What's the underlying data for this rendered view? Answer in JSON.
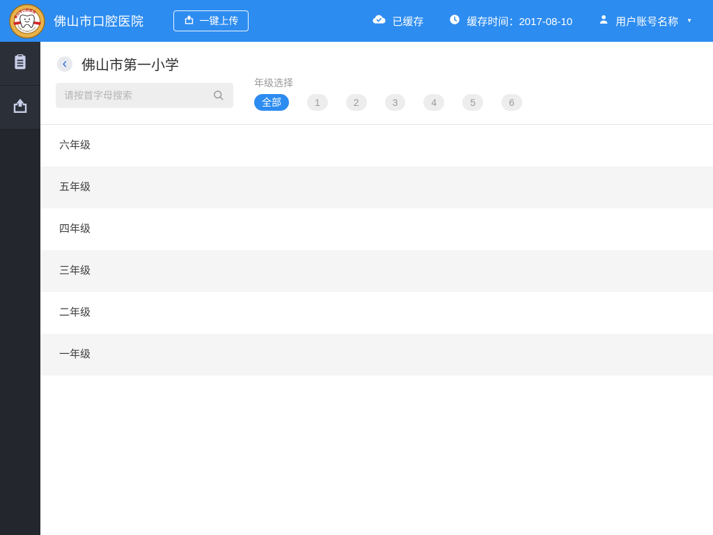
{
  "colors": {
    "primary": "#2d8cf0",
    "header_bg": "#2d8cf0",
    "sidebar_bg": "#23262d",
    "sidebar_item_bg": "#2b2f38",
    "row_alt_bg": "#f5f5f6",
    "chip_gray_bg": "#ededee",
    "logo_ring": "#e8b24a",
    "logo_ribbon": "#d42222"
  },
  "icons": {
    "caret_down": "▼"
  },
  "header": {
    "app_title": "佛山市口腔医院",
    "upload_button_label": "一键上传",
    "cached_status": "已缓存",
    "cache_time": "缓存时间：2017-08-10",
    "user_account": "用户账号名称"
  },
  "sidebar": {
    "items": [
      {
        "id": "records",
        "icon": "clipboard-icon"
      },
      {
        "id": "upload",
        "icon": "upload-icon"
      }
    ]
  },
  "main": {
    "school_title": "佛山市第一小学",
    "search_placeholder": "请按首字母搜索",
    "grade_select_label": "年级选择",
    "grade_chips": [
      {
        "label": "全部",
        "selected": true
      },
      {
        "label": "1",
        "selected": false
      },
      {
        "label": "2",
        "selected": false
      },
      {
        "label": "3",
        "selected": false
      },
      {
        "label": "4",
        "selected": false
      },
      {
        "label": "5",
        "selected": false
      },
      {
        "label": "6",
        "selected": false
      }
    ],
    "grades": [
      "六年级",
      "五年级",
      "四年级",
      "三年级",
      "二年级",
      "一年级"
    ]
  }
}
